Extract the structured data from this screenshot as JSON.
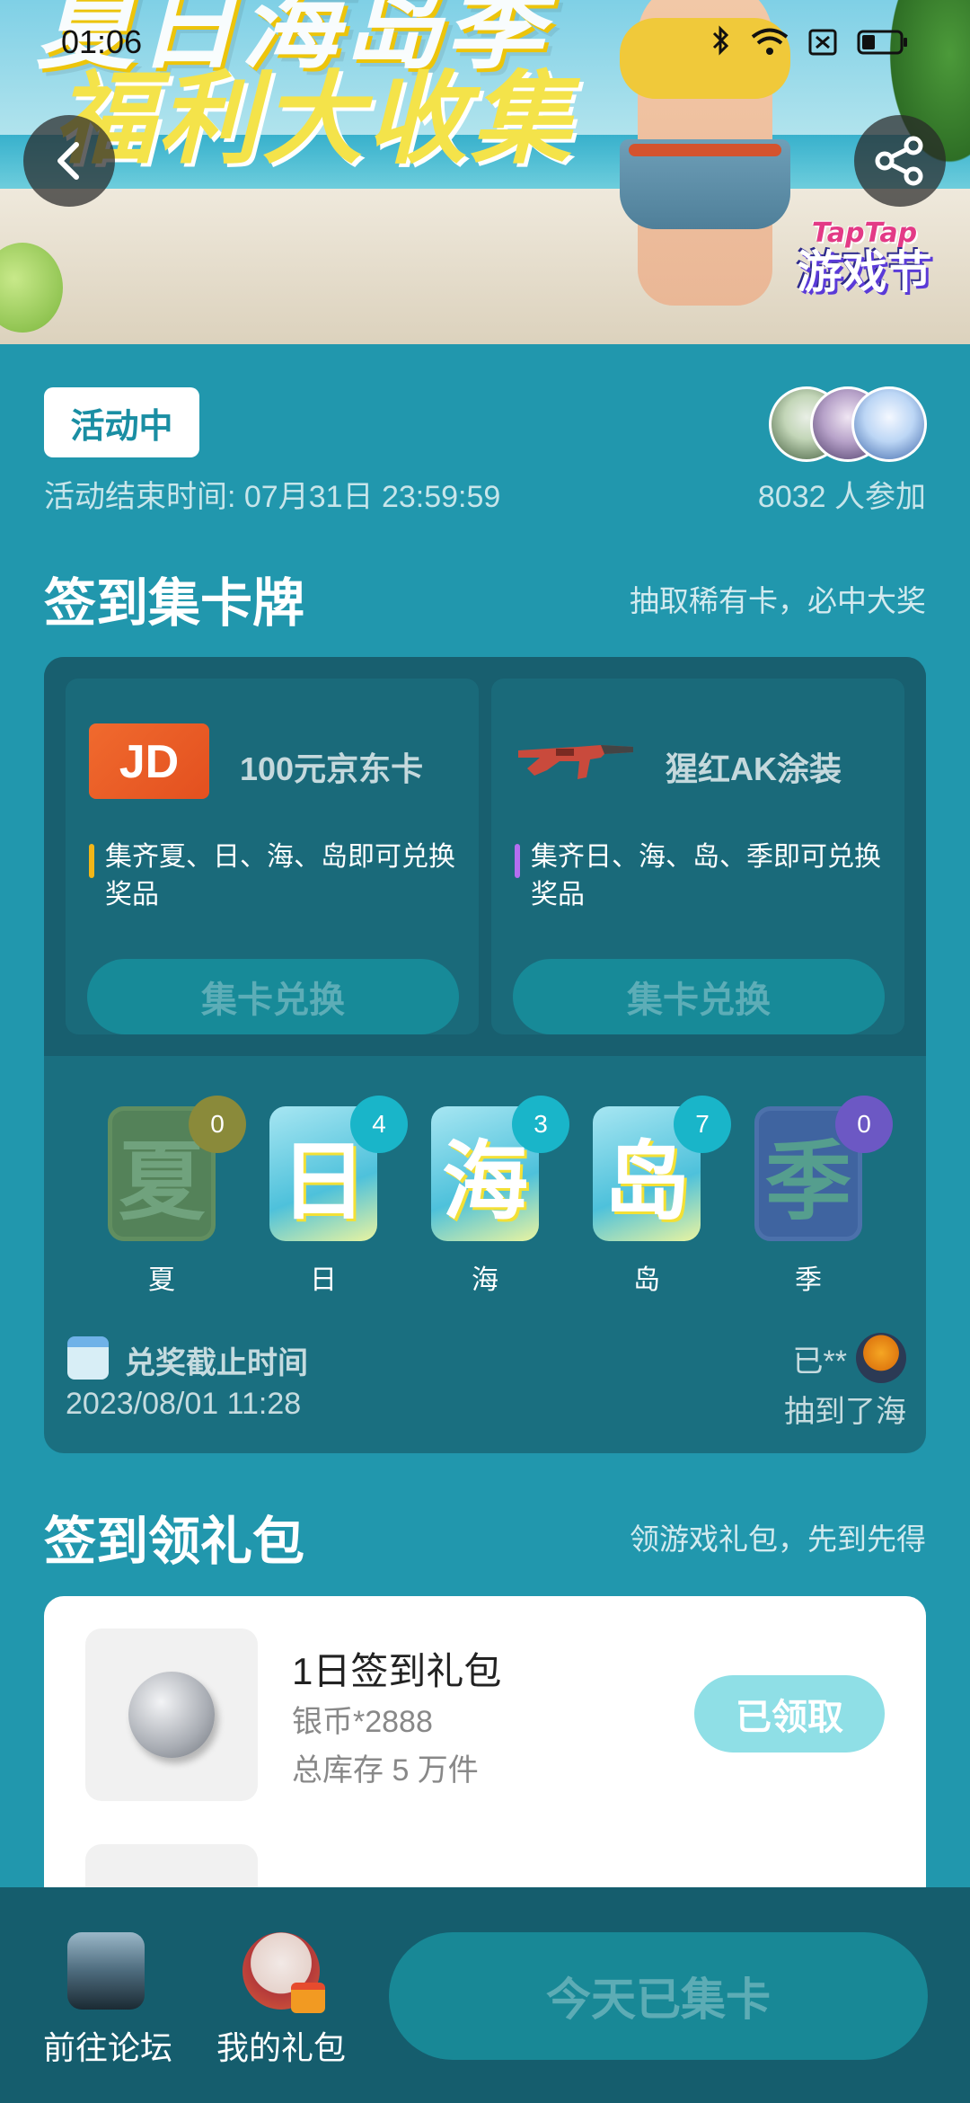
{
  "status_bar": {
    "time": "01:06"
  },
  "hero": {
    "title_line1": "夏日海岛季",
    "title_line2": "福利大收集",
    "badge_line1": "TapTap",
    "badge_line2": "游戏节"
  },
  "activity": {
    "status_tag": "活动中",
    "end_time": "活动结束时间: 07月31日 23:59:59",
    "participants": "8032 人参加"
  },
  "collect_section": {
    "title": "签到集卡牌",
    "subtitle": "抽取稀有卡，必中大奖",
    "prizes": [
      {
        "name": "100元京东卡",
        "desc": "集齐夏、日、海、岛即可兑换奖品",
        "button": "集卡兑换",
        "bar_color": "#f2b618",
        "image_icon": "jd-card-icon"
      },
      {
        "name": "猩红AK涂装",
        "desc": "集齐日、海、岛、季即可兑换奖品",
        "button": "集卡兑换",
        "bar_color": "#b46ef0",
        "image_icon": "ak-rifle-icon"
      }
    ],
    "cards": [
      {
        "char": "夏",
        "label": "夏",
        "count": "0",
        "owned": false,
        "badge_color": "#8a8a3a",
        "tile_color": "#9a9a2a"
      },
      {
        "char": "日",
        "label": "日",
        "count": "4",
        "owned": true,
        "badge_color": "#19b5c9"
      },
      {
        "char": "海",
        "label": "海",
        "count": "3",
        "owned": true,
        "badge_color": "#19b5c9"
      },
      {
        "char": "岛",
        "label": "岛",
        "count": "7",
        "owned": true,
        "badge_color": "#19b5c9"
      },
      {
        "char": "季",
        "label": "季",
        "count": "0",
        "owned": false,
        "badge_color": "#6c58c4",
        "tile_color": "#6d57c8"
      }
    ],
    "deadline_label": "兑奖截止时间",
    "deadline_value": "2023/08/01 11:28",
    "winner_name": "已**",
    "winner_text": "抽到了海"
  },
  "gift_section": {
    "title": "签到领礼包",
    "subtitle": "领游戏礼包，先到先得",
    "items": [
      {
        "title": "1日签到礼包",
        "reward": "银币*2888",
        "stock": "总库存 5 万件",
        "button": "已领取"
      }
    ]
  },
  "bottom_bar": {
    "forum_label": "前往论坛",
    "gift_label": "我的礼包",
    "cta": "今天已集卡"
  }
}
